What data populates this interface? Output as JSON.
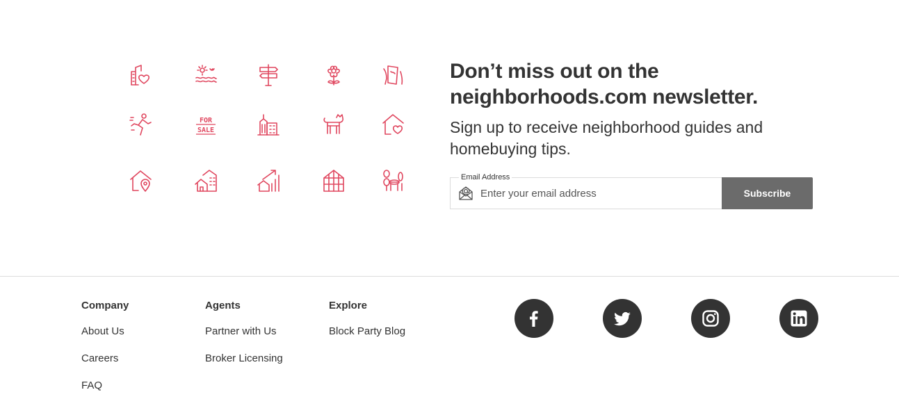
{
  "feature_icons": [
    {
      "name": "city-heart-icon"
    },
    {
      "name": "sunset-water-icon"
    },
    {
      "name": "signpost-icon"
    },
    {
      "name": "flower-icon"
    },
    {
      "name": "hand-map-icon"
    },
    {
      "name": "runner-icon"
    },
    {
      "name": "for-sale-sign-icon",
      "text_line1": "FOR",
      "text_line2": "SALE"
    },
    {
      "name": "buildings-icon"
    },
    {
      "name": "cat-icon"
    },
    {
      "name": "home-heart-icon"
    },
    {
      "name": "home-location-icon"
    },
    {
      "name": "houses-icon"
    },
    {
      "name": "home-growth-icon"
    },
    {
      "name": "greenhouse-icon"
    },
    {
      "name": "balloon-dog-icon"
    }
  ],
  "newsletter": {
    "title": "Don’t miss out on the neighborhoods.com newsletter.",
    "subtitle": "Sign up to receive neighborhood guides and homebuying tips.",
    "email_label": "Email Address",
    "email_placeholder": "Enter your email address",
    "email_value": "",
    "subscribe_label": "Subscribe"
  },
  "footer": {
    "columns": [
      {
        "heading": "Company",
        "links": [
          "About Us",
          "Careers",
          "FAQ"
        ]
      },
      {
        "heading": "Agents",
        "links": [
          "Partner with Us",
          "Broker Licensing"
        ]
      },
      {
        "heading": "Explore",
        "links": [
          "Block Party Blog"
        ]
      }
    ],
    "social": [
      {
        "icon": "facebook-icon"
      },
      {
        "icon": "twitter-icon"
      },
      {
        "icon": "instagram-icon"
      },
      {
        "icon": "linkedin-icon"
      }
    ]
  },
  "colors": {
    "icon_accent": "#e0475f",
    "text": "#333333",
    "button_bg": "#6b6b6b",
    "social_bg": "#333333",
    "divider": "#dddddd"
  }
}
